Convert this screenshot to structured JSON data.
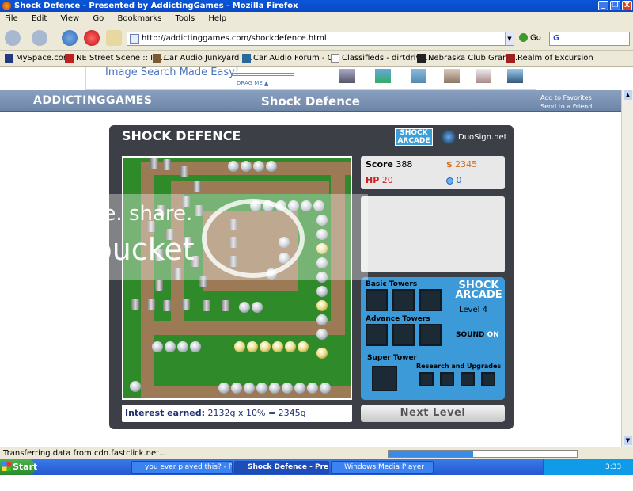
{
  "window": {
    "title": "Shock Defence - Presented by AddictingGames - Mozilla Firefox",
    "controls": [
      "_",
      "❐",
      "X"
    ]
  },
  "menu": [
    "File",
    "Edit",
    "View",
    "Go",
    "Bookmarks",
    "Tools",
    "Help"
  ],
  "navbar": {
    "url": "http://addictinggames.com/shockdefence.html",
    "go_label": "Go",
    "search_placeholder": "G"
  },
  "bookmarks": [
    "MySpace.com",
    "NE Street Scene :: In...",
    "Car Audio Junkyard -...",
    "Car Audio Forum - C...",
    "Classifieds - dirtdrive...",
    "Nebraska Club Grand...",
    "Realm of Excursion"
  ],
  "banner": {
    "text": "Image Search Made Easy!",
    "drag_label": "DRAG ME ▲"
  },
  "site": {
    "logo": "ADDICTINGGAMES",
    "game_title": "Shock Defence",
    "add_favorites": "Add to Favorites",
    "send_friend": "Send to a Friend"
  },
  "game": {
    "title": "SHOCK DEFENCE",
    "brand_logo": "SHOCK ARCADE",
    "sponsor": "DuoSign.net",
    "stats": {
      "score_label": "Score",
      "score": "388",
      "money_symbol": "$",
      "money": "2345",
      "hp_label": "HP",
      "hp": "20",
      "orbs": "0"
    },
    "panel": {
      "basic_towers": "Basic Towers",
      "advance_towers": "Advance Towers",
      "super_tower": "Super Tower",
      "research": "Research and Upgrades",
      "level": "Level 4",
      "sound_label": "SOUND",
      "sound_state": "ON",
      "logo": "SHOCK ARCADE"
    },
    "interest": {
      "label": "Interest earned:",
      "value": "2132g x 10% = 2345g"
    },
    "next_level": "Next Level"
  },
  "watermark": {
    "line1": "host. store. share.",
    "line2": "photobucket"
  },
  "status": {
    "text": "Transferring data from cdn.fastclick.net...",
    "progress_fraction": 0.45
  },
  "taskbar": {
    "start": "Start",
    "tasks": [
      "you ever played this? - P...",
      "Shock Defence - Pres...",
      "Windows Media Player"
    ],
    "time": "3:33 AM"
  },
  "colors": {
    "title_blue": "#0a56d8",
    "game_bg": "#3c3f45",
    "grass": "#2f8a2a",
    "dirt": "#9c7a55",
    "panel_blue": "#3c9ad8",
    "hp_red": "#d02020",
    "money_orange": "#d07020"
  }
}
